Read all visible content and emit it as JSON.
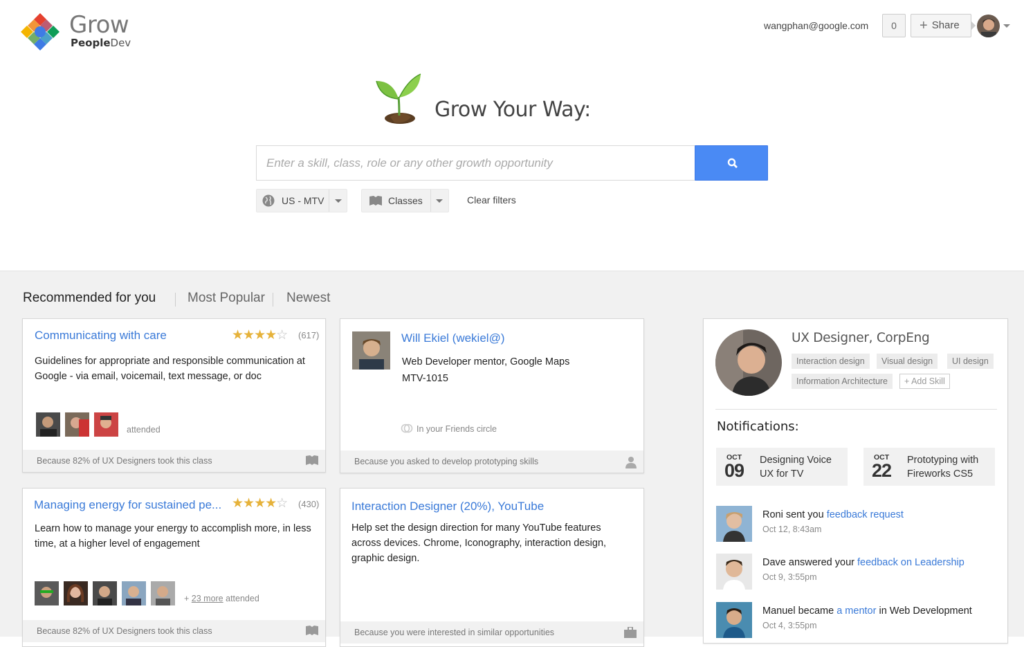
{
  "header": {
    "app_name": "Grow",
    "app_sub_bold": "People",
    "app_sub_rest": "Dev",
    "email": "wangphan@google.com",
    "notification_count": "0",
    "share_label": "Share"
  },
  "hero": {
    "title": "Grow Your Way:",
    "search_placeholder": "Enter a skill, class, role or any other growth opportunity",
    "filters": {
      "location": "US - MTV",
      "type": "Classes",
      "clear": "Clear filters"
    }
  },
  "tabs": [
    {
      "label": "Recommended for you"
    },
    {
      "label": "Most Popular"
    },
    {
      "label": "Newest"
    }
  ],
  "cards": {
    "c1": {
      "title": "Communicating with care",
      "rating": 4,
      "rating_count": "(617)",
      "desc": "Guidelines for appropriate and responsible communication at Google - via email, voicemail, text message, or doc",
      "attended": "attended",
      "footer": "Because 82% of UX Designers took this class"
    },
    "c2": {
      "title": "Will Ekiel (wekiel@)",
      "desc_line1": "Web Developer mentor, Google Maps",
      "desc_line2": "MTV-1015",
      "circle_note": "In your Friends circle",
      "footer": "Because you asked to develop prototyping skills"
    },
    "c3": {
      "title": "Managing energy for sustained pe...",
      "rating": 4,
      "rating_count": "(430)",
      "desc": "Learn how to manage your energy to accomplish more, in less time, at a higher level of engagement",
      "more_prefix": "+ ",
      "more_link": "23 more",
      "more_suffix": " attended",
      "footer": "Because 82% of UX Designers took this class"
    },
    "c4": {
      "title": "Interaction Designer (20%), YouTube",
      "desc": "Help set the design direction for many YouTube features across devices. Chrome, Iconography, interaction design, graphic design.",
      "footer": "Because you were interested in similar opportunities"
    }
  },
  "profile": {
    "role": "UX Designer, CorpEng",
    "skills": [
      "Interaction design",
      "Visual design",
      "UI design",
      "Information Architecture"
    ],
    "add_skill": "+ Add Skill",
    "notifications_title": "Notifications:",
    "events": [
      {
        "month": "OCT",
        "day": "09",
        "title": "Designing Voice UX for TV"
      },
      {
        "month": "OCT",
        "day": "22",
        "title": "Prototyping with Fireworks CS5"
      }
    ],
    "notifications": [
      {
        "pre": "Roni sent you ",
        "link": "feedback request",
        "post": "",
        "time": "Oct 12, 8:43am"
      },
      {
        "pre": "Dave answered your ",
        "link": "feedback on Leadership",
        "post": "",
        "time": "Oct 9, 3:55pm"
      },
      {
        "pre": "Manuel became ",
        "link": "a mentor",
        "post": " in Web Development",
        "time": "Oct 4, 3:55pm"
      }
    ]
  },
  "colors": {
    "accent_blue": "#4a8af4",
    "link_blue": "#3a7ad8",
    "star_gold": "#e6b23a",
    "bg_gray": "#f1f1f1"
  }
}
